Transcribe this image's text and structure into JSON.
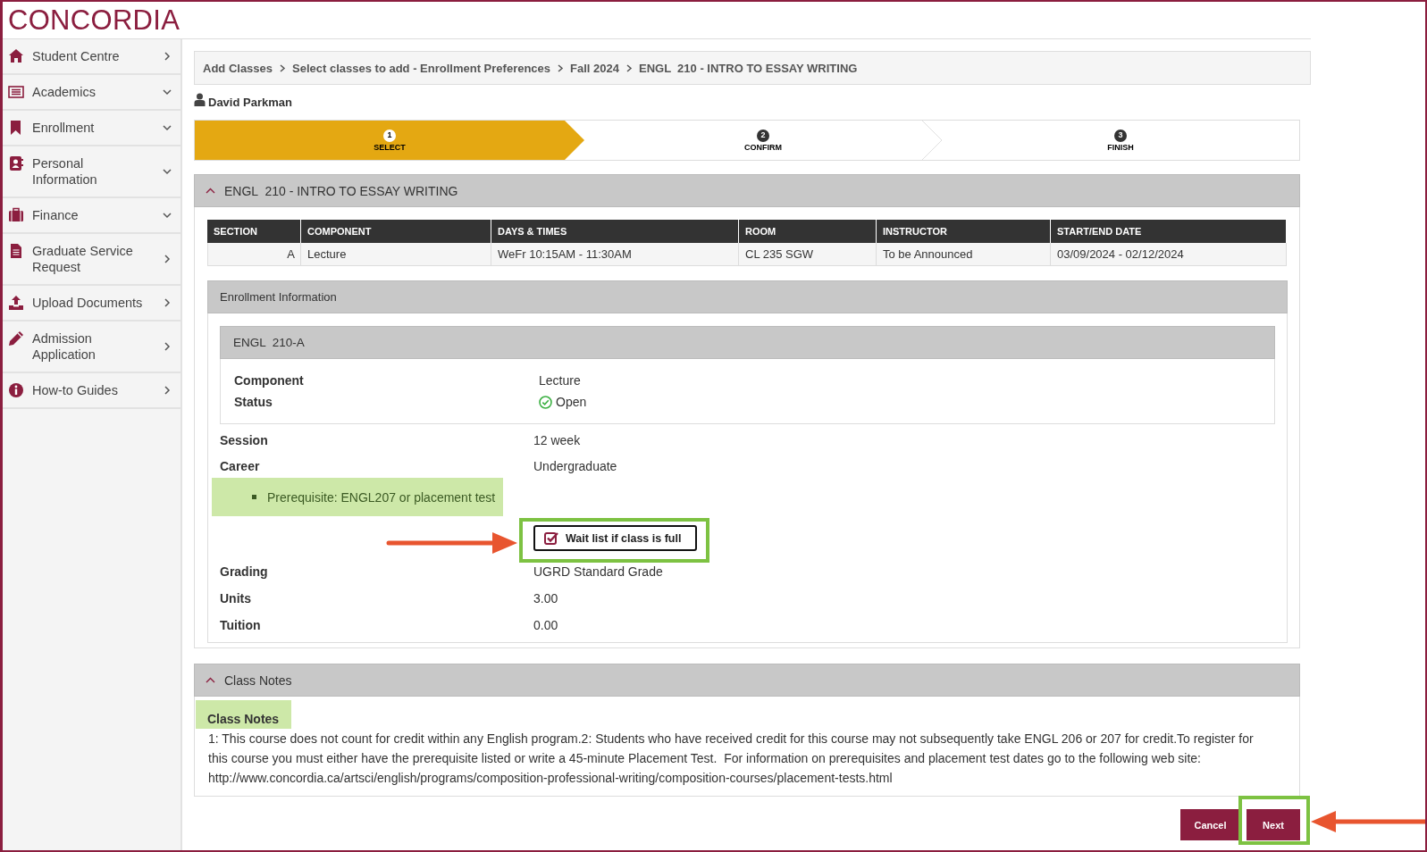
{
  "header": {
    "logo": "CONCORDIA"
  },
  "sidebar": {
    "items": [
      {
        "label": "Student Centre",
        "kind": "link"
      },
      {
        "label": "Academics",
        "kind": "menu"
      },
      {
        "label": "Enrollment",
        "kind": "menu"
      },
      {
        "label": "Personal Information",
        "kind": "menu"
      },
      {
        "label": "Finance",
        "kind": "menu"
      },
      {
        "label": "Graduate Service Request",
        "kind": "link"
      },
      {
        "label": "Upload Documents",
        "kind": "link"
      },
      {
        "label": "Admission Application",
        "kind": "link"
      },
      {
        "label": "How-to Guides",
        "kind": "link"
      }
    ]
  },
  "breadcrumb": [
    "Add Classes",
    "Select classes to add - Enrollment Preferences",
    "Fall 2024",
    "ENGL  210 - INTRO TO ESSAY WRITING"
  ],
  "user": {
    "name": "David Parkman"
  },
  "steps": [
    {
      "number": "1",
      "label": "SELECT",
      "selected": true
    },
    {
      "number": "2",
      "label": "CONFIRM",
      "selected": false
    },
    {
      "number": "3",
      "label": "FINISH",
      "selected": false
    }
  ],
  "class_panel": {
    "title": "ENGL  210 - INTRO TO ESSAY WRITING",
    "expanded": true,
    "table": {
      "columns": [
        "SECTION",
        "COMPONENT",
        "DAYS & TIMES",
        "ROOM",
        "INSTRUCTOR",
        "START/END DATE"
      ],
      "rows": [
        [
          "A",
          "Lecture",
          "WeFr 10:15AM - 11:30AM",
          "CL 235 SGW",
          "To be Announced",
          "03/09/2024 - 02/12/2024"
        ]
      ]
    },
    "enrollment": {
      "title": "Enrollment Information",
      "section": {
        "title": "ENGL  210-A",
        "fields": [
          {
            "kind": "field",
            "label": "Component",
            "value": "Lecture"
          },
          {
            "kind": "status",
            "label": "Status",
            "value": "Open"
          }
        ]
      },
      "rows": [
        {
          "kind": "field",
          "label": "Session",
          "value": "12 week"
        },
        {
          "kind": "field",
          "label": "Career",
          "value": "Undergraduate"
        },
        {
          "kind": "note",
          "text": "Prerequisite: ENGL207 or placement test"
        },
        {
          "kind": "option",
          "label": "Wait list if class is full",
          "checked": true
        },
        {
          "kind": "field",
          "label": "Grading",
          "value": "UGRD Standard Grade"
        },
        {
          "kind": "field",
          "label": "Units",
          "value": "3.00"
        },
        {
          "kind": "field",
          "label": "Tuition",
          "value": "0.00"
        }
      ]
    }
  },
  "notes_panel": {
    "title": "Class Notes",
    "expanded": true,
    "heading": "Class Notes",
    "text": "1: This course does not count for credit within any English program.2: Students who have received credit for this course may not subsequently take ENGL 206 or 207 for credit.To register for this course you must either have the prerequisite listed or write a 45-minute Placement Test.  For information on prerequisites and placement test dates go to the following web site: http://www.concordia.ca/artsci/english/programs/composition-professional-writing/composition-courses/placement-tests.html"
  },
  "buttons": [
    "Cancel",
    "Next"
  ]
}
